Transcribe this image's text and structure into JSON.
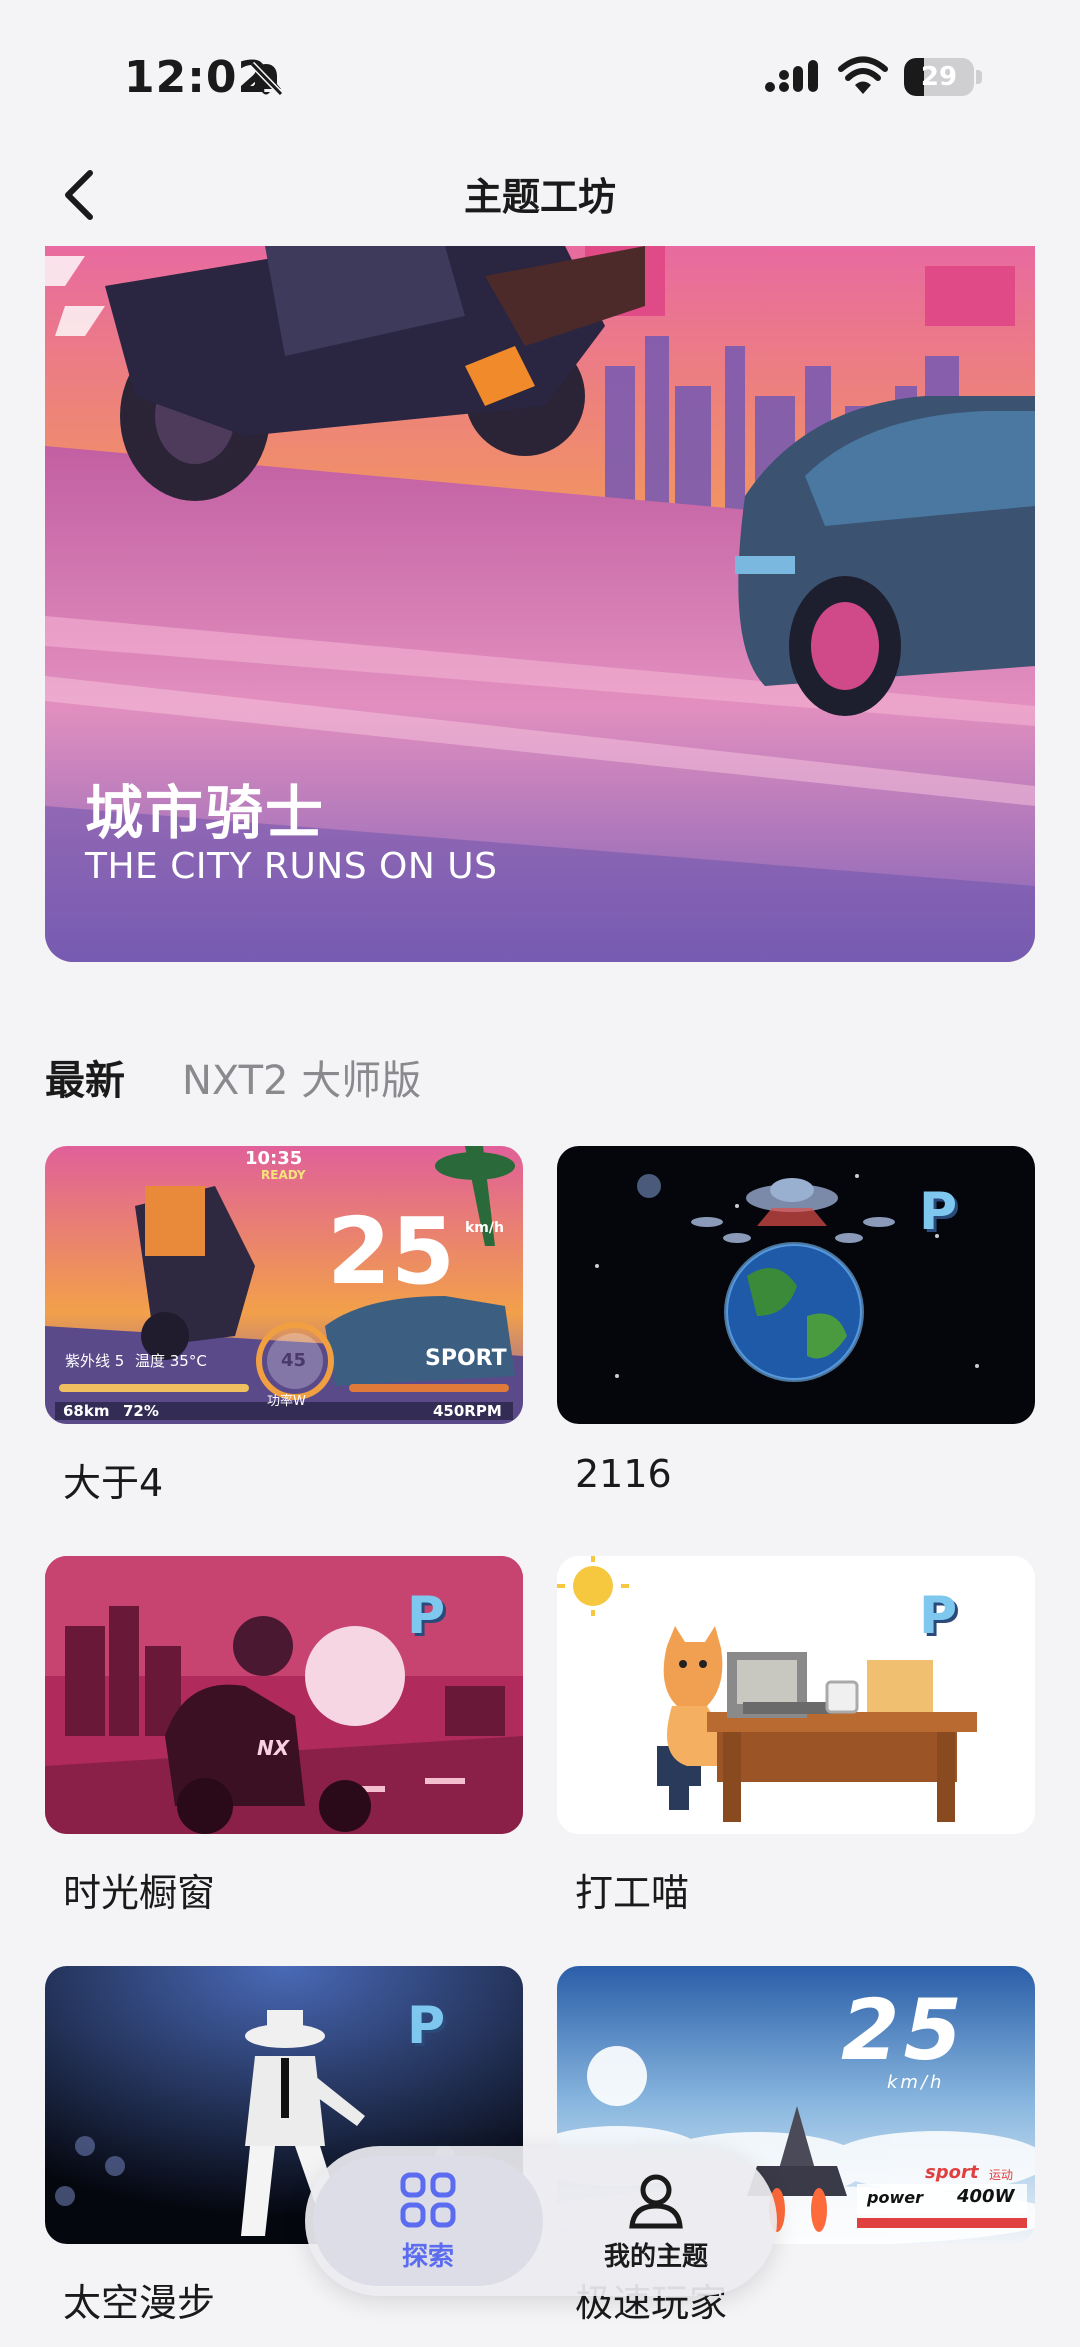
{
  "status_bar": {
    "time": "12:02",
    "battery": "29",
    "battery_level": 0.29
  },
  "header": {
    "title": "主题工坊"
  },
  "hero": {
    "title": "城市骑士",
    "subtitle": "THE CITY RUNS ON US"
  },
  "tabs": [
    {
      "label": "最新"
    },
    {
      "label": "NXT2 大师版"
    }
  ],
  "themes": [
    {
      "name": "大于4",
      "thumb": {
        "time": "10:35",
        "ready": "READY",
        "speed": "25",
        "unit": "km/h",
        "uv": "紫外线 5",
        "temp": "温度 35°C",
        "power_value": "45",
        "power_label": "功率W",
        "mode": "SPORT",
        "range": "68km",
        "battery": "72%",
        "rpm": "450RPM"
      }
    },
    {
      "name": "2116",
      "thumb": {
        "badge": "P"
      }
    },
    {
      "name": "时光橱窗",
      "thumb": {
        "badge": "P",
        "plate": "NX"
      }
    },
    {
      "name": "打工喵",
      "thumb": {
        "badge": "P"
      }
    },
    {
      "name": "太空漫步",
      "thumb": {
        "badge": "P"
      }
    },
    {
      "name": "极速玩家",
      "thumb": {
        "speed": "25",
        "unit": "km/h",
        "mode": "sport",
        "mode_cn": "运动",
        "power_label": "power",
        "power_value": "400W"
      }
    }
  ],
  "bottom_nav": {
    "explore": "探索",
    "my_themes": "我的主题"
  },
  "colors": {
    "accent": "#5b6cf0",
    "badge": "#7ec8f0"
  }
}
